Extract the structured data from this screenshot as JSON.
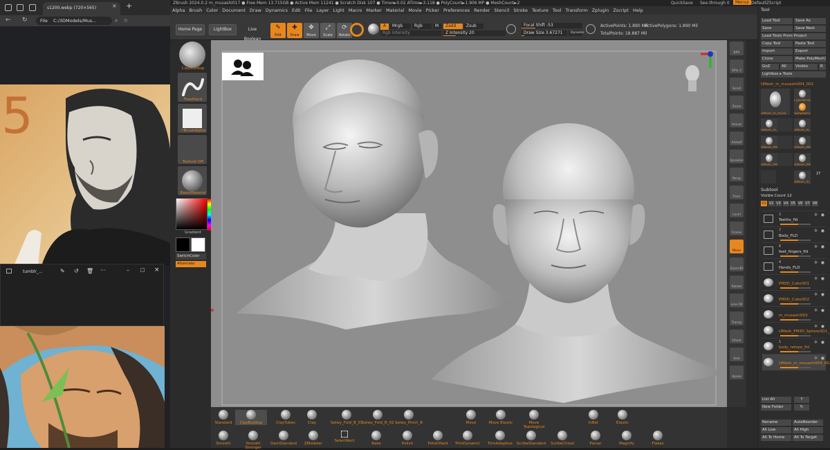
{
  "browser": {
    "tab_title": "s1200.webp (720×565)",
    "url_prefix": "File",
    "url": "C:/3DModels/Mus...",
    "photo_window_title": "tumblr_..."
  },
  "zbrush": {
    "title": "ZBrush 2024.0.2   m_musashi017   ● Free Mem 13.715GB ● Active Mem 11241 ● Scratch Disk 107 ● Timer►0.02 ATime►3.118 ● PolyCount►1.906 MP ● MeshCount►2",
    "quicksave": "QuickSave",
    "seethrough": "See-through  0",
    "menus_btn": "Menus",
    "default_script": "DefaultZScript",
    "menus": [
      "Alpha",
      "Brush",
      "Color",
      "Document",
      "Draw",
      "Dynamics",
      "Edit",
      "File",
      "Layer",
      "Light",
      "Macro",
      "Marker",
      "Material",
      "Movie",
      "Picker",
      "Preferences",
      "Render",
      "Stencil",
      "Stroke",
      "Texture",
      "Tool",
      "Transform",
      "Zplugin",
      "Zscript",
      "Help"
    ],
    "top_shelf": {
      "home_page": "Home Page",
      "lightbox": "LightBox",
      "live_boolean": "Live Boolean",
      "tools": [
        "Edit",
        "Draw",
        "Move",
        "Scale",
        "Rotate"
      ],
      "a_label": "A",
      "mrgb": "Mrgb",
      "rgb": "Rgb",
      "m": "M",
      "zadd": "Zadd",
      "zsub": "Zsub",
      "rgb_intensity": "Rgb Intensity",
      "z_intensity": "Z Intensity  20",
      "focal_shift": "Focal Shift  -53",
      "draw_size": "Draw Size  3.67271",
      "dynamic": "Dynamic",
      "active_points": "ActivePoints: 1.890 Mil",
      "total_points": "TotalPoints: 18.887 Mil",
      "active_polygons": "ActivePolygons: 1.890 Mil"
    },
    "left_shelf": {
      "brush": "ClayBuildup",
      "stroke": "FreeHand",
      "alpha": "~BrushAlpha",
      "texture": "Texture Off",
      "material": "BasicMaterial",
      "gradient": "Gradient",
      "switch_color": "SwitchColor",
      "alternate": "Alternate"
    },
    "right_shelf": [
      "BPR",
      "SPix 3",
      "Scroll",
      "Zoom",
      "Actual",
      "AAHalf",
      "Dynamic",
      "Persp",
      "Floor",
      "Local",
      "Frame",
      "Move",
      "Zoom3D",
      "Rotate",
      "Line Fill PolyF",
      "Transp",
      "Ghost",
      "Solo",
      "Xpose"
    ],
    "tool_panel": {
      "title": "Tool",
      "buttons": [
        [
          "Load Tool",
          "Save As"
        ],
        [
          "Save",
          "Save Next"
        ],
        [
          "Load Tools From Project"
        ],
        [
          "Copy Tool",
          "Paste Tool"
        ],
        [
          "Import",
          "Export"
        ],
        [
          "Clone",
          "Make PolyMesh3D"
        ],
        [
          "GoZ",
          "All",
          "Visible",
          "R"
        ],
        [
          "Lightbox ▸ Tools"
        ]
      ],
      "current_tool": "UMesh_m_musashi004_002",
      "thumbnails": [
        "UMesh_m_musa",
        "Cylinder3D",
        "SimpleBrush",
        "UMesh_m_musa",
        "UMesh_m_musa",
        "UMesh_PM3D_S",
        "UMesh_PM3D_S",
        "UMesh_PM3D_S",
        "UMesh_PM3D_S",
        "UMesh_m_musa"
      ],
      "thumb_count": "27",
      "subtool_title": "Subtool",
      "visible_count": "Visible Count 12",
      "view_tabs": [
        "V1",
        "V2",
        "V3",
        "V4",
        "V5",
        "V6",
        "V7",
        "V8"
      ],
      "subtools": [
        {
          "num": "2",
          "name": "Teeths_fld"
        },
        {
          "num": "7",
          "name": "Body_FLD"
        },
        {
          "num": "6",
          "name": "feet_fingers_fld"
        },
        {
          "num": "4",
          "name": "Hands_FLD"
        },
        {
          "num": "",
          "name": "PM3D_Cube3D1"
        },
        {
          "num": "",
          "name": "PM3D_Cube3D2"
        },
        {
          "num": "",
          "name": "m_musashi003"
        },
        {
          "num": "",
          "name": "UMesh_PM3D_Sphere3D1_11"
        },
        {
          "num": "1",
          "name": "body_retopo_fld"
        },
        {
          "num": "",
          "name": "UMesh_m_musashi004_002"
        }
      ],
      "bottom_buttons": [
        [
          "List All",
          "↑"
        ],
        [
          "New Folder",
          "↻"
        ],
        [
          "Rename",
          "AutoReorder"
        ],
        [
          "All Low",
          "All High"
        ],
        [
          "All To Home",
          "All To Target"
        ]
      ]
    },
    "brushes_row1": [
      "Standard",
      "ClayBuildup",
      "ClayTubes",
      "Clay",
      "Selwy_Fold_B_01",
      "Selwy_Fold_B_02",
      "Selwy_Pinch_B",
      "Move",
      "Move Elastic",
      "Move Topological",
      "InBet",
      "Elastic"
    ],
    "brushes_row2": [
      "Smooth",
      "Smooth Stronger",
      "DamStandard",
      "ZModeler",
      "SelectRect",
      "Rake",
      "Polish",
      "PolishHard",
      "TrimDynamic",
      "TrimAdaptive",
      "ScribeStandard",
      "ScribeChisel",
      "Planar",
      "Magnify",
      "Flakes"
    ]
  }
}
